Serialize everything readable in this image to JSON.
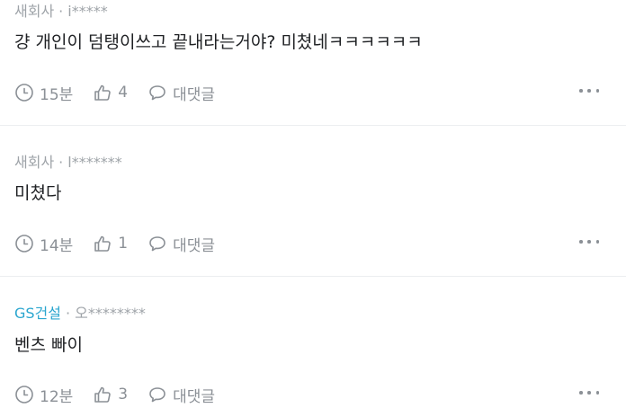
{
  "comments": [
    {
      "company": "새회사",
      "separator": "·",
      "user": "i*****",
      "text": "걍 개인이 덤탱이쓰고 끝내라는거야? 미쳤네ㅋㅋㅋㅋㅋㅋ",
      "time": "15분",
      "likes": "4",
      "reply_label": "대댓글"
    },
    {
      "company": "새회사",
      "separator": "·",
      "user": "l*******",
      "text": "미쳤다",
      "time": "14분",
      "likes": "1",
      "reply_label": "대댓글"
    },
    {
      "company": "GS건설",
      "separator": "·",
      "user": "오********",
      "text": "벤츠 빠이",
      "time": "12분",
      "likes": "3",
      "reply_label": "대댓글"
    }
  ],
  "colors": {
    "company_accent": "#2ba6cf",
    "meta_gray": "#9ea3a8",
    "text": "#1f2124",
    "icon_gray": "#8b9096",
    "divider": "#eceef0"
  },
  "icons": {
    "time": "clock-icon",
    "like": "thumbs-up-icon",
    "reply": "speech-bubble-icon",
    "more": "more-dots-icon"
  }
}
